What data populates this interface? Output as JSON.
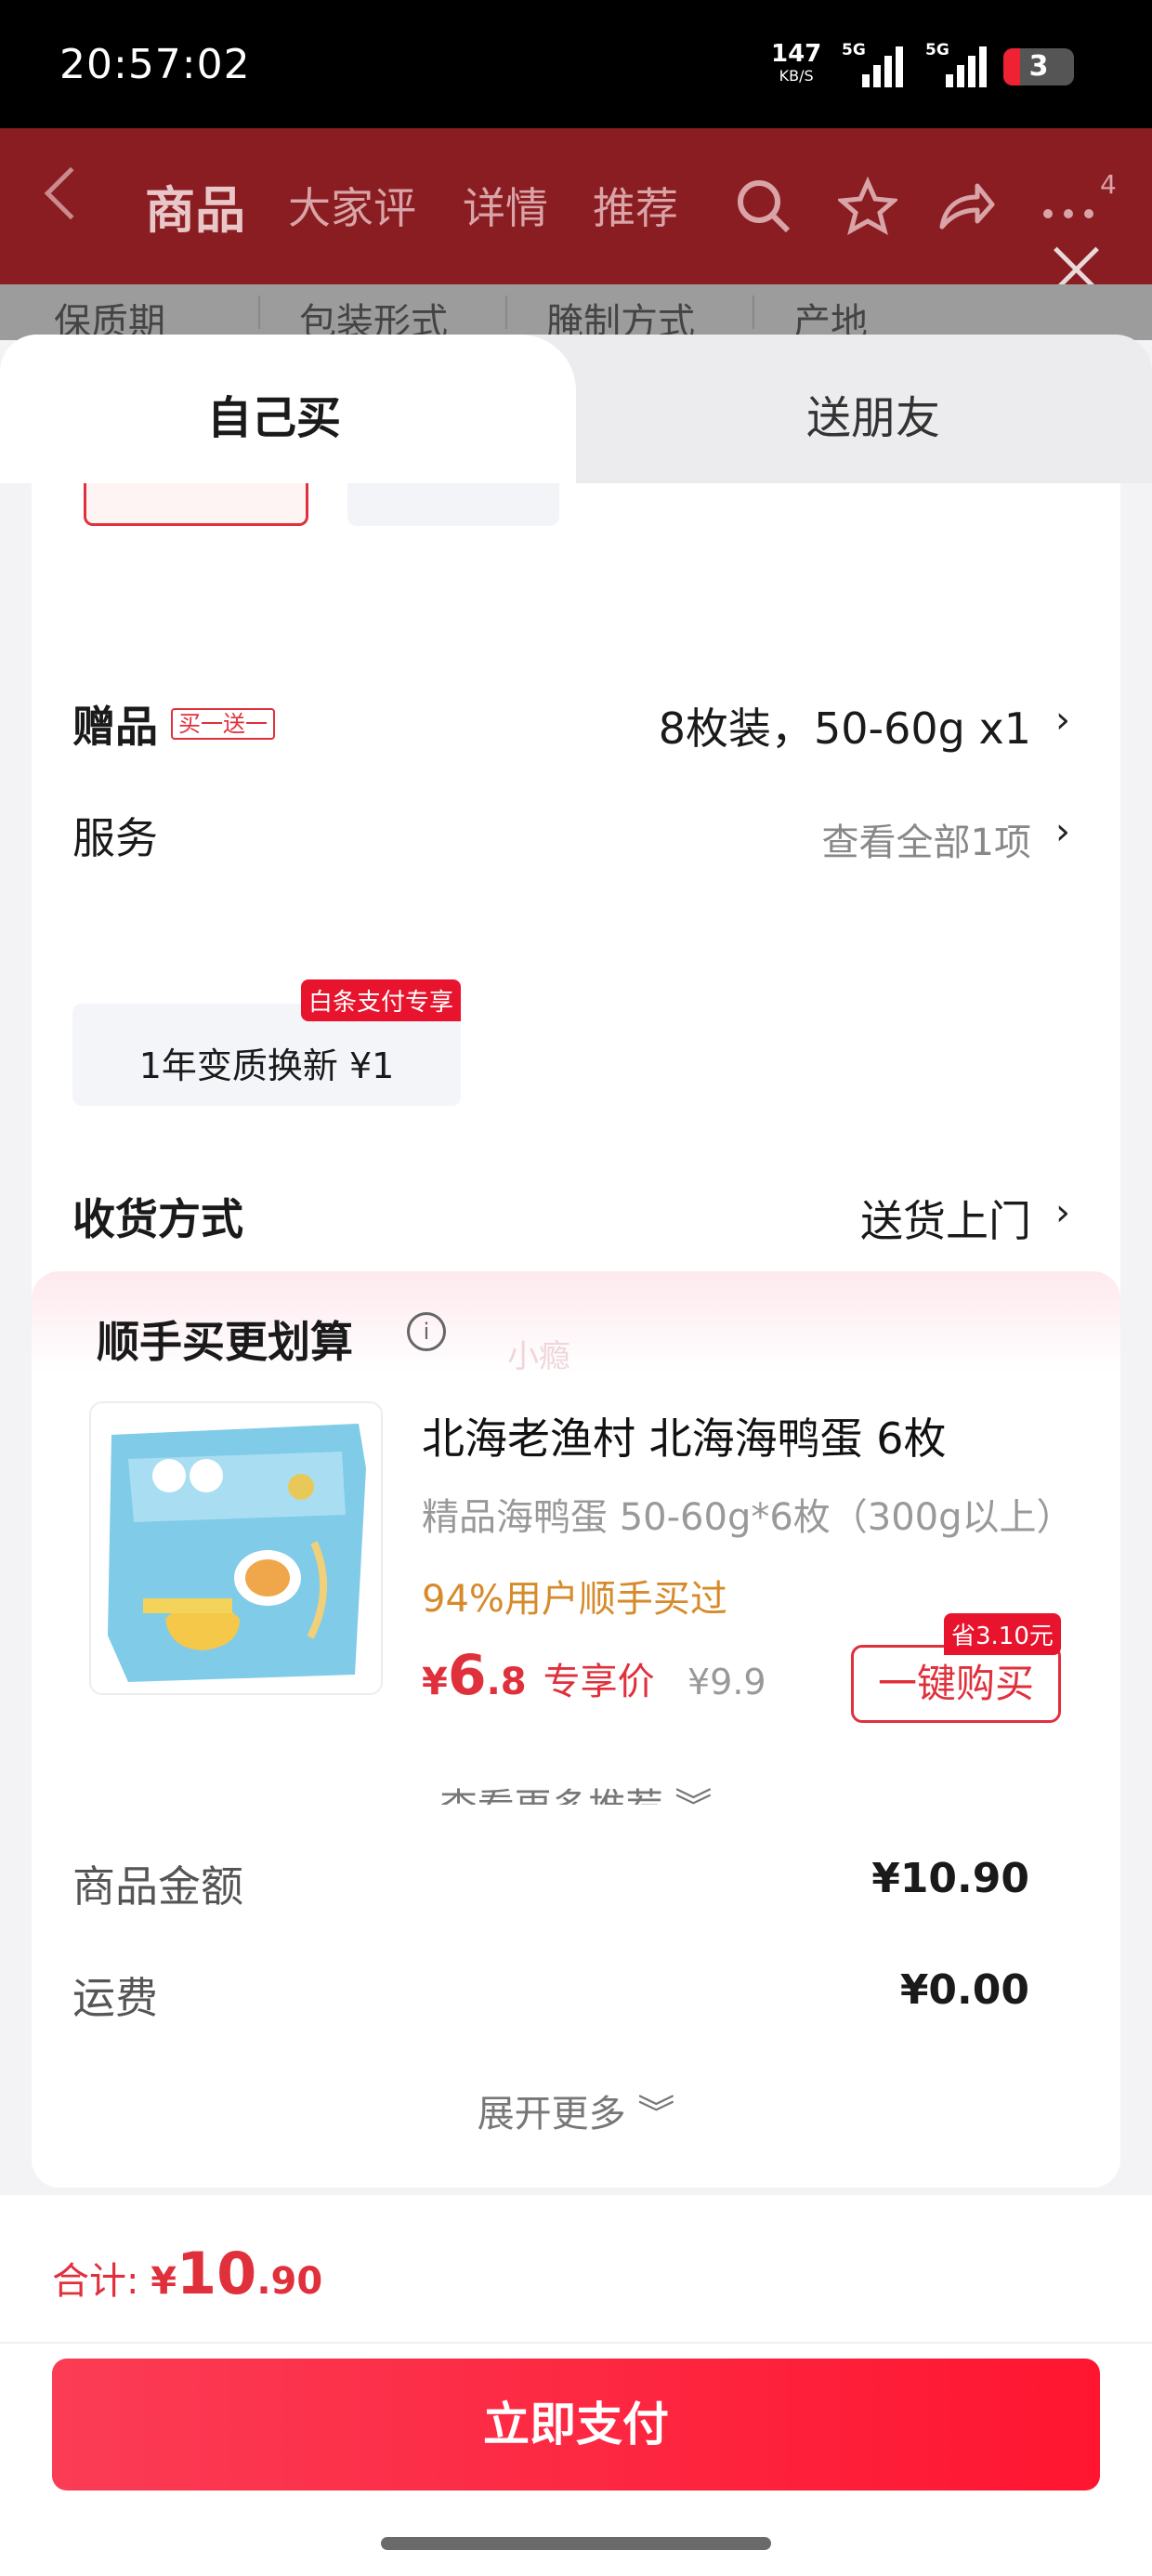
{
  "status_bar": {
    "time": "20:57:02",
    "net_speed": "147",
    "net_unit": "KB/S",
    "sim1_label": "5G",
    "sim2_label": "5G",
    "battery": "3"
  },
  "nav": {
    "tabs": [
      "商品",
      "大家评",
      "详情",
      "推荐"
    ],
    "active_tab": "商品",
    "badge": "4",
    "icons": [
      "back-icon",
      "search-icon",
      "star-icon",
      "share-icon",
      "more-icon",
      "close-icon"
    ]
  },
  "spec_row": [
    "保质期",
    "包装形式",
    "腌制方式",
    "产地"
  ],
  "buy_mode": {
    "self": "自己买",
    "gift": "送朋友"
  },
  "gift": {
    "label": "赠品",
    "tag": "买一送一",
    "value": "8枚装，50-60g x1"
  },
  "service": {
    "label": "服务",
    "link": "查看全部1项",
    "option_text": "1年变质换新  ¥1",
    "option_ribbon": "白条支付专享"
  },
  "delivery": {
    "label": "收货方式",
    "value": "送货上门"
  },
  "recommend": {
    "title": "顺手买更划算",
    "watermark": "小瘾",
    "product_title": "北海老渔村 北海海鸭蛋 6枚",
    "product_sub": "精品海鸭蛋 50-60g*6枚（300g以上）",
    "bought_text": "94%用户顺手买过",
    "price_currency": "¥",
    "price_int": "6",
    "price_dec": ".8",
    "price_label": "专享价",
    "original_price": "¥9.9",
    "save_tag": "省3.10元",
    "buy_button": "一键购买",
    "more_link": "查看更多推荐 ︾"
  },
  "summary": {
    "items_label": "商品金额",
    "items_value": "¥10.90",
    "shipping_label": "运费",
    "shipping_value": "¥0.00",
    "expand": "展开更多 ︾"
  },
  "footer": {
    "total_label": "合计: ",
    "total_currency": "¥",
    "total_int": "10",
    "total_dec": ".90",
    "pay_button": "立即支付"
  },
  "colors": {
    "accent_red": "#e0303c",
    "pay_gradient_start": "#fb3c55",
    "pay_gradient_end": "#ff1530",
    "bought_orange": "#d68a2a"
  }
}
